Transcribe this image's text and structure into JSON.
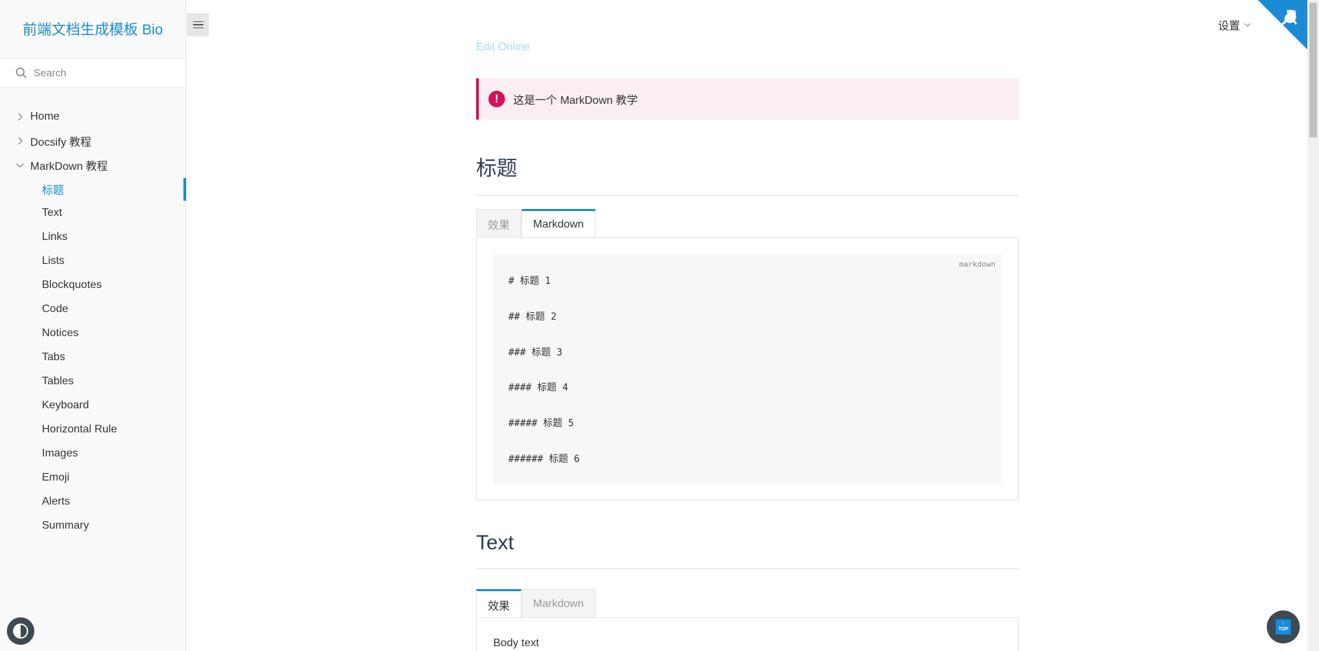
{
  "sidebar": {
    "app_name": "前端文档生成模板 Bio",
    "search_placeholder": "Search",
    "items": [
      {
        "label": "Home"
      },
      {
        "label": "Docsify 教程"
      },
      {
        "label": "MarkDown 教程"
      }
    ],
    "sub_items": [
      {
        "label": "标题"
      },
      {
        "label": "Text"
      },
      {
        "label": "Links"
      },
      {
        "label": "Lists"
      },
      {
        "label": "Blockquotes"
      },
      {
        "label": "Code"
      },
      {
        "label": "Notices"
      },
      {
        "label": "Tabs"
      },
      {
        "label": "Tables"
      },
      {
        "label": "Keyboard"
      },
      {
        "label": "Horizontal Rule"
      },
      {
        "label": "Images"
      },
      {
        "label": "Emoji"
      },
      {
        "label": "Alerts"
      },
      {
        "label": "Summary"
      }
    ]
  },
  "header": {
    "settings_label": "设置"
  },
  "content": {
    "edit_online": "Edit Online",
    "notice_text": "这是一个 MarkDown 教学",
    "section1": {
      "title": "标题",
      "tab_effect": "效果",
      "tab_markdown": "Markdown",
      "code_lang": "markdown",
      "code_lines": [
        "# 标题 1",
        "## 标题 2",
        "### 标题 3",
        "#### 标题 4",
        "##### 标题 5",
        "###### 标题 6"
      ]
    },
    "section2": {
      "title": "Text",
      "tab_effect": "效果",
      "tab_markdown": "Markdown",
      "body_text": "Body text"
    }
  },
  "back_to_top": {
    "label": "TOP"
  },
  "colors": {
    "accent": "#1c8bd6",
    "notice": "#d6115a",
    "notice_bg": "#fbeef2"
  }
}
